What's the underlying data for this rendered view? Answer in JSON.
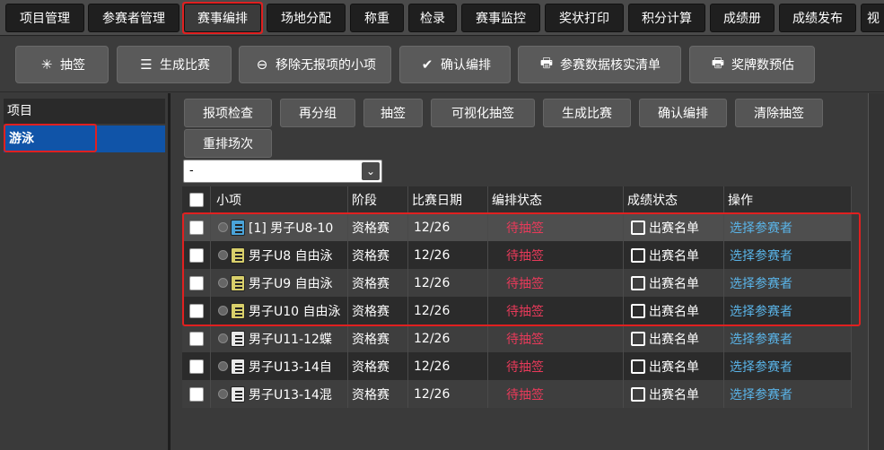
{
  "topnav": {
    "tabs": [
      {
        "label": "项目管理"
      },
      {
        "label": "参赛者管理"
      },
      {
        "label": "赛事编排"
      },
      {
        "label": "场地分配"
      },
      {
        "label": "称重"
      },
      {
        "label": "检录"
      },
      {
        "label": "赛事监控"
      },
      {
        "label": "奖状打印"
      },
      {
        "label": "积分计算"
      },
      {
        "label": "成绩册"
      },
      {
        "label": "成绩发布"
      },
      {
        "label": "视"
      }
    ],
    "active_index": 2
  },
  "toolbar": {
    "buttons": [
      {
        "label": "抽签",
        "icon": "sparkle-icon"
      },
      {
        "label": "生成比赛",
        "icon": "list-icon"
      },
      {
        "label": "移除无报项的小项",
        "icon": "minus-circle-icon"
      },
      {
        "label": "确认编排",
        "icon": "check-icon"
      },
      {
        "label": "参赛数据核实清单",
        "icon": "printer-icon"
      },
      {
        "label": "奖牌数预估",
        "icon": "printer-icon"
      }
    ]
  },
  "left_panel": {
    "header": "项目",
    "selected_item": "游泳"
  },
  "actions": {
    "buttons": [
      "报项检查",
      "再分组",
      "抽签",
      "可视化抽签",
      "生成比赛",
      "确认编排",
      "清除抽签",
      "重排场次"
    ]
  },
  "filter": {
    "selected": "-"
  },
  "grid": {
    "headers": [
      "小项",
      "阶段",
      "比赛日期",
      "编排状态",
      "成绩状态",
      "操作"
    ],
    "rows": [
      {
        "event": "[1] 男子U8-10",
        "stage": "资格赛",
        "date": "12/26",
        "status": "待抽签",
        "result": "出赛名单",
        "action": "选择参赛者",
        "icon_color": "#4aa3d8"
      },
      {
        "event": "男子U8 自由泳",
        "stage": "资格赛",
        "date": "12/26",
        "status": "待抽签",
        "result": "出赛名单",
        "action": "选择参赛者",
        "icon_color": "#d8cf6a"
      },
      {
        "event": "男子U9 自由泳",
        "stage": "资格赛",
        "date": "12/26",
        "status": "待抽签",
        "result": "出赛名单",
        "action": "选择参赛者",
        "icon_color": "#d8cf6a"
      },
      {
        "event": "男子U10 自由泳",
        "stage": "资格赛",
        "date": "12/26",
        "status": "待抽签",
        "result": "出赛名单",
        "action": "选择参赛者",
        "icon_color": "#d8cf6a"
      },
      {
        "event": "男子U11-12蝶",
        "stage": "资格赛",
        "date": "12/26",
        "status": "待抽签",
        "result": "出赛名单",
        "action": "选择参赛者",
        "icon_color": "#e8e8e8"
      },
      {
        "event": "男子U13-14自",
        "stage": "资格赛",
        "date": "12/26",
        "status": "待抽签",
        "result": "出赛名单",
        "action": "选择参赛者",
        "icon_color": "#e8e8e8"
      },
      {
        "event": "男子U13-14混",
        "stage": "资格赛",
        "date": "12/26",
        "status": "待抽签",
        "result": "出赛名单",
        "action": "选择参赛者",
        "icon_color": "#e8e8e8"
      }
    ]
  },
  "colors": {
    "highlight": "#e02020",
    "selected_blue": "#1054a8",
    "status_red": "#e83a5a",
    "link_blue": "#5ab4e8"
  }
}
